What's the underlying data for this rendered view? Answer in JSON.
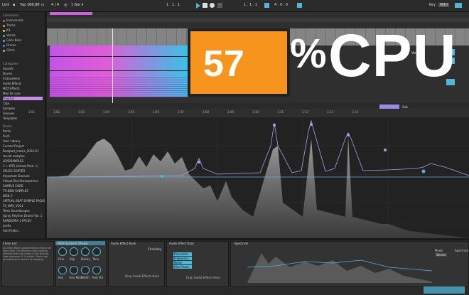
{
  "topbar": {
    "link": "Link",
    "tap": "Tap",
    "tempo": "100.00",
    "signature": "4 / 4",
    "position": "1 . 1 . 1",
    "loop_length": "4 . 0 . 0",
    "key": "Key",
    "midi": "MIDI"
  },
  "browser": {
    "collections_head": "Collections",
    "collections": [
      {
        "label": "Instruments",
        "color": "#e05a5a"
      },
      {
        "label": "Tracks",
        "color": "#e0a24a"
      },
      {
        "label": "Kit",
        "color": "#e0d84a"
      },
      {
        "label": "Vocals",
        "color": "#5ac85a"
      },
      {
        "label": "Color Bass",
        "color": "#4ab4e0"
      },
      {
        "label": "Drums",
        "color": "#8a6ae0"
      },
      {
        "label": "Glitch",
        "color": "#b0b0b0"
      }
    ],
    "categories_head": "Categories",
    "categories": [
      "Sounds",
      "Drums",
      "Instruments",
      "Audio Effects",
      "MIDI Effects",
      "Max for Live",
      "Plug-Ins",
      "Clips",
      "Samples",
      "Grooves",
      "Templates"
    ],
    "places_head": "Places",
    "places": [
      "Packs",
      "Push",
      "User Library",
      "Current Project",
      "Beatport_tracks_2024-01",
      "recent samples",
      "LEADSAMPLES",
      "1 + KITS (virtual Pack +)",
      "SPLICE SORTED",
      "Important Grooves",
      "Virtual Riot Atmospheres",
      "SAMPLE CORE",
      "TR NEW SAMPLES",
      "DISK C",
      "VIRTUAL BEAT SAMPLE PACKS",
      "FX_WAV_VOL1",
      "Telex Soundscapes",
      "Spray Rhythm Drums Vol. 1",
      "RANDOMIX 1 PACKS",
      "prefix",
      "Add Folder..."
    ]
  },
  "arrangement": {
    "ruler": [
      "1:01",
      "1:02",
      "1:03",
      "1:04",
      "1:05",
      "1:06",
      "1:07",
      "1:08",
      "1:09",
      "1:10",
      "1:11",
      "1:12",
      "1:13",
      "1:14"
    ],
    "track_name": "Vocals",
    "sends": "Solo",
    "clip_label": "Sub"
  },
  "cpu": {
    "value": "57",
    "percent": "%",
    "label": "CPU"
  },
  "spectrum": {
    "accent": "#4fb7d8",
    "curve_color": "#a8a0e8"
  },
  "device": {
    "chain_title": "Chain List",
    "chain_text": "All of this Rack's parallel device chains are listed here. The devices in the currently selected chain are shown in the Devices view whenever 'A' is visible. Chains can be reordered or moved by dragging.",
    "rack1_title": "MIDI Dynamic Shaper",
    "rack1_knobs": [
      "Fine",
      "Blip",
      "Decay",
      "Tone",
      "Pan",
      "Env Mod",
      "Width",
      "Rvb Vol"
    ],
    "rack2_title": "Audio Effect Rack",
    "rack2_tabs": [
      "Chain",
      "Key"
    ],
    "rack2_drop": "Drop Audio Effects Here",
    "rack3_title": "Audio Effect Rack",
    "rack3_rows": [
      "Resonator",
      "Frequency",
      "Noise",
      "Dist Phase"
    ],
    "rack3_drop": "Drop Audio Effects Here",
    "spec_title": "Spectrum",
    "mode_label": "Mode",
    "mode_value": "Stereo",
    "eq_label": "Spectrum"
  }
}
